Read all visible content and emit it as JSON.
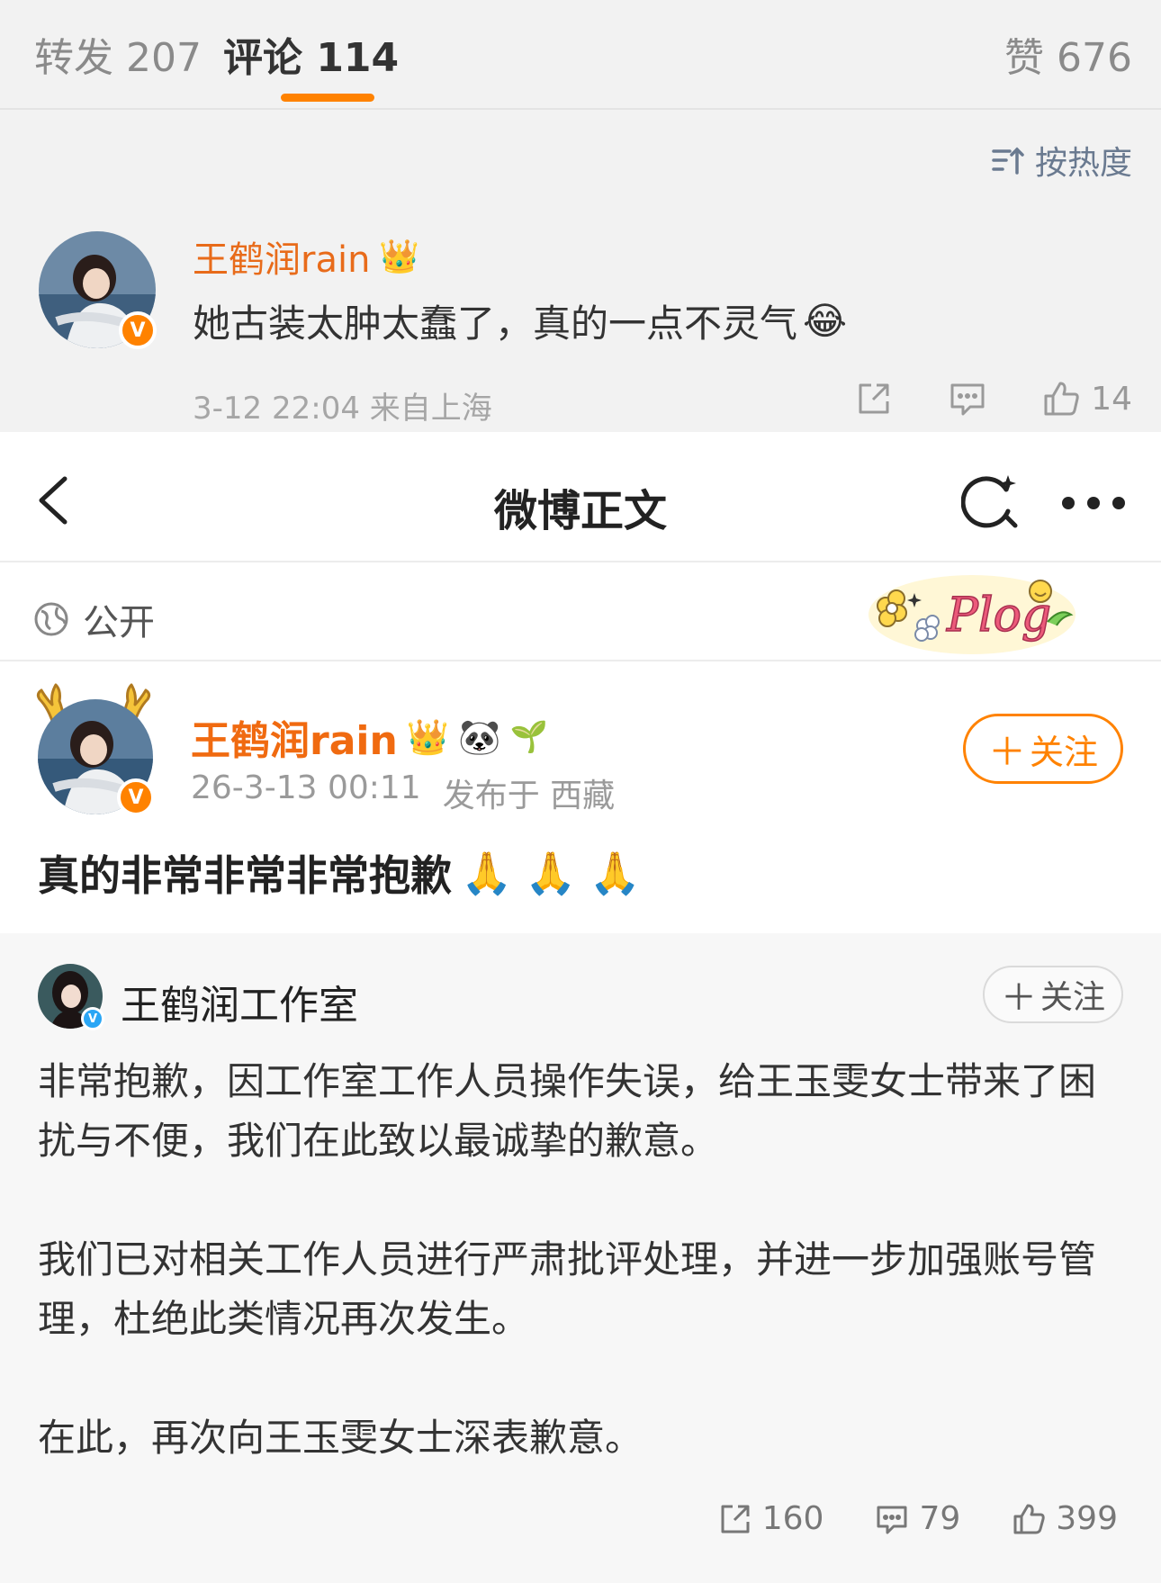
{
  "comments_header": {
    "repost_tab": "转发 207",
    "comment_tab": "评论 114",
    "likes_tab": "赞 676",
    "sort_label": "按热度",
    "accent_color": "#ff8200"
  },
  "comment": {
    "author": "王鹤润rain",
    "text": "她古装太肿太蠢了，真的一点不灵气",
    "emoji": "😂",
    "meta": "3-12 22:04 来自上海",
    "like_count": "14",
    "icons": [
      "share-icon",
      "reply-icon",
      "like-icon"
    ]
  },
  "nav": {
    "title": "微博正文",
    "icons": [
      "back-icon",
      "search-icon",
      "more-icon"
    ]
  },
  "visibility": {
    "label": "公开",
    "sticker_text": "Plog"
  },
  "post": {
    "author": "王鹤润rain",
    "date": "26-3-13 00:11",
    "location": "发布于 西藏",
    "follow_label": "关注",
    "text": "真的非常非常非常抱歉",
    "emojis": [
      "🙏",
      "🙏",
      "🙏"
    ],
    "author_emojis": [
      "👑",
      "🐼",
      "🌱"
    ]
  },
  "repost": {
    "author": "王鹤润工作室",
    "follow_label": "关注",
    "paragraphs": [
      "非常抱歉，因工作室工作人员操作失误，给王玉雯女士带来了困扰与不便，我们在此致以最诚挚的歉意。",
      "我们已对相关工作人员进行严肃批评处理，并进一步加强账号管理，杜绝此类情况再次发生。",
      "在此，再次向王玉雯女士深表歉意。"
    ],
    "share_count": "160",
    "comment_count": "79",
    "like_count": "399"
  }
}
